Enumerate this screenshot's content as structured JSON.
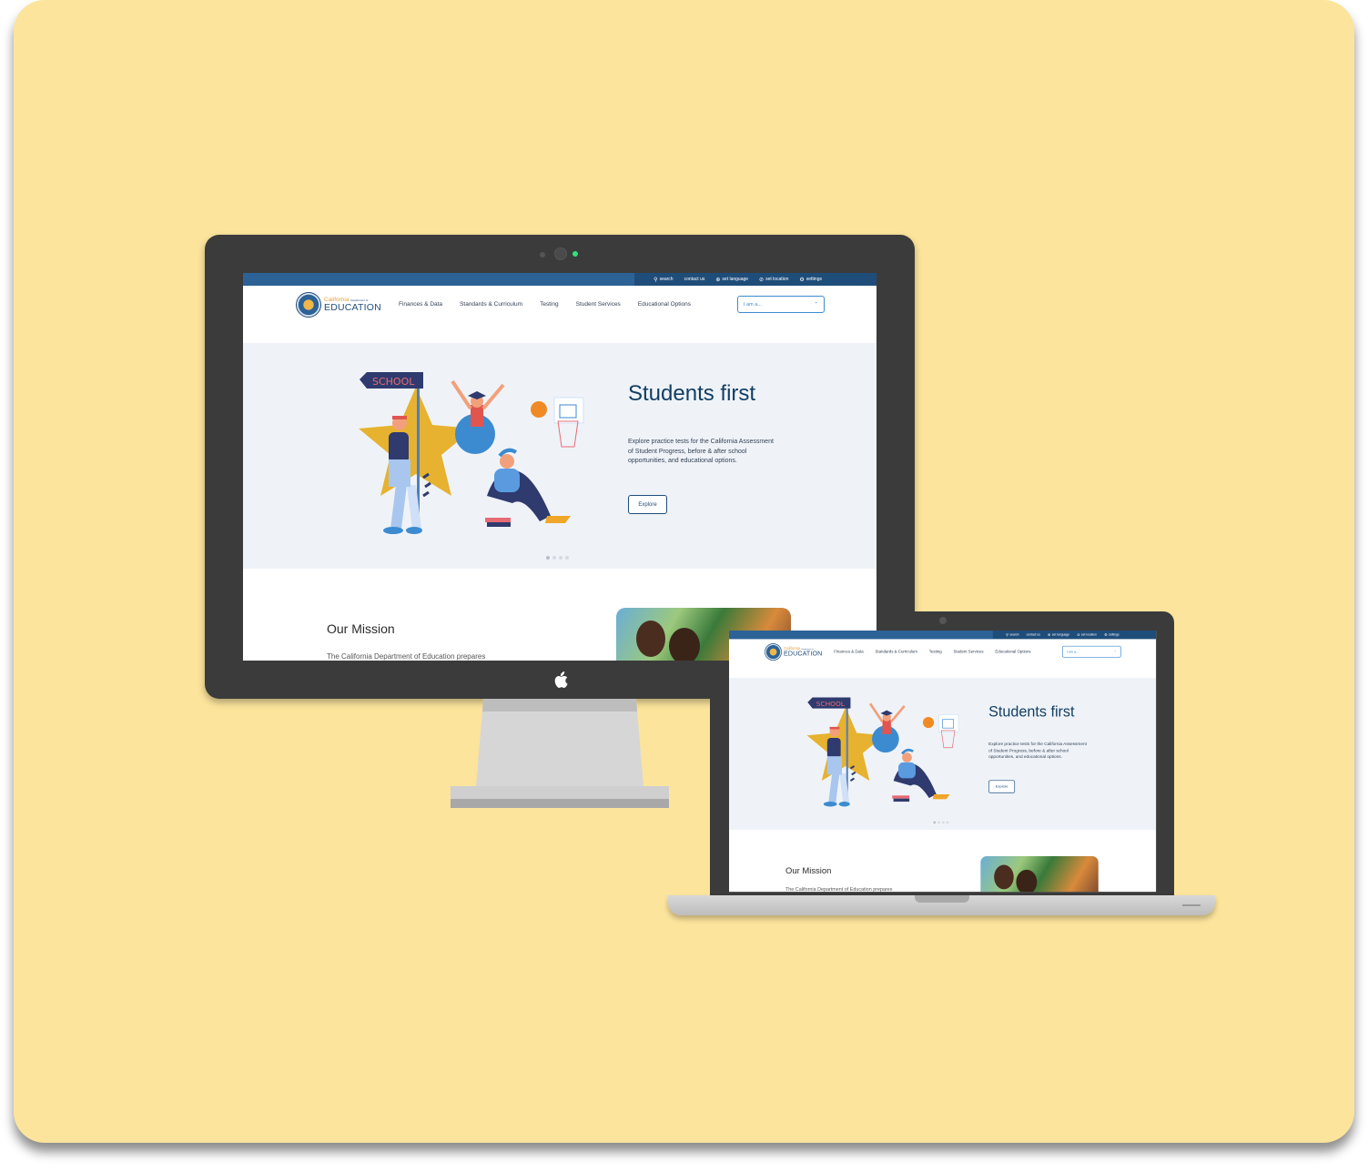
{
  "site": {
    "utility_links": [
      {
        "icon": "search-icon",
        "label": "search"
      },
      {
        "icon": "",
        "label": "contact us"
      },
      {
        "icon": "globe-icon",
        "label": "set language"
      },
      {
        "icon": "location-icon",
        "label": "set location"
      },
      {
        "icon": "gear-icon",
        "label": "settings"
      }
    ],
    "logo": {
      "top": "California",
      "small": "Department of",
      "main": "EDUCATION"
    },
    "nav": [
      "Finances & Data",
      "Standards & Curriculum",
      "Testing",
      "Student Services",
      "Educational Options"
    ],
    "role_select": {
      "value": "I am a..."
    },
    "hero": {
      "title": "Students first",
      "text": "Explore practice tests for the California Assessment of Student Progress, before & after school opportunities, and educational options.",
      "button": "Explore",
      "slides": 4,
      "active_slide": 1,
      "sign_text": "SCHOOL"
    },
    "mission": {
      "title": "Our Mission",
      "text": "The California Department of Education prepares"
    }
  },
  "colors": {
    "background": "#fce49c",
    "device_bezel": "#3b3b3b",
    "brand_blue": "#1f4d7a",
    "hero_bg": "#eff3f8",
    "accent_gold": "#e6b22f"
  }
}
